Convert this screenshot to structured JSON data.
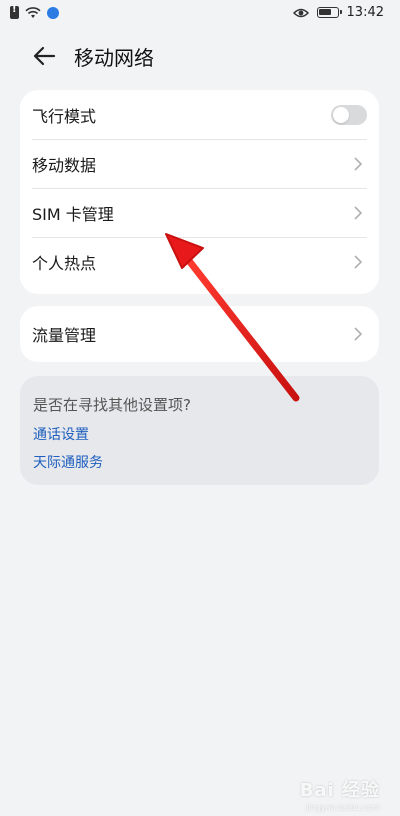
{
  "status_bar": {
    "time": "13:42",
    "icons": [
      "sim-alert-icon",
      "wifi-icon",
      "app-notification-icon",
      "eye-icon",
      "battery-icon"
    ]
  },
  "header": {
    "title": "移动网络",
    "back_icon": "arrow-left-icon"
  },
  "settings_group_1": {
    "items": [
      {
        "label": "飞行模式",
        "control": "toggle",
        "state": "off"
      },
      {
        "label": "移动数据",
        "control": "chevron"
      },
      {
        "label": "SIM 卡管理",
        "control": "chevron"
      },
      {
        "label": "个人热点",
        "control": "chevron"
      }
    ]
  },
  "settings_group_2": {
    "items": [
      {
        "label": "流量管理",
        "control": "chevron"
      }
    ]
  },
  "suggestions": {
    "title": "是否在寻找其他设置项?",
    "links": [
      "通话设置",
      "天际通服务"
    ]
  },
  "colors": {
    "background": "#f1f3f5",
    "card": "#ffffff",
    "link": "#1f5fbf",
    "annotation_arrow": "#e8191b"
  },
  "watermark": {
    "text": "Bai 经验",
    "sub": "jingyan.baidu.com"
  }
}
